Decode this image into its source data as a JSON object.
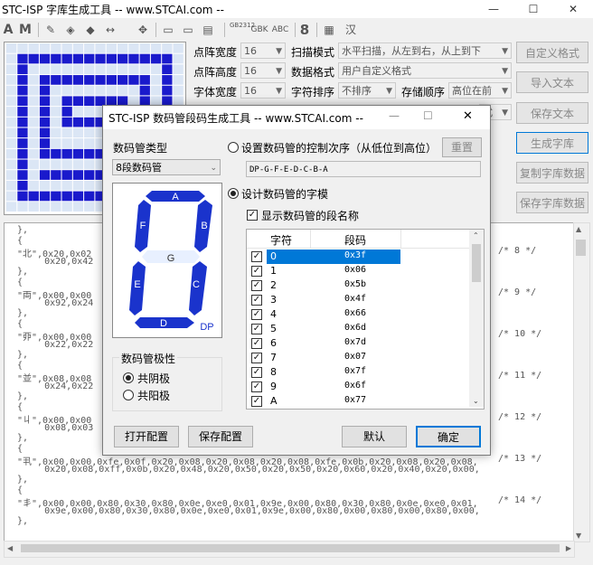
{
  "main_window": {
    "title": "STC-ISP 字库生成工具 -- www.STCAI.com --",
    "min": "—",
    "max": "☐",
    "close": "✕"
  },
  "toolbar": [
    "A",
    "M",
    "✎",
    "◈",
    "◆",
    "↔",
    "✥",
    "▭",
    "▭",
    "▤",
    "GB2312",
    "GBK",
    "ABC",
    "8",
    "▦",
    "汉"
  ],
  "settings": {
    "dot_width_label": "点阵宽度",
    "dot_width_value": "16",
    "dot_height_label": "点阵高度",
    "dot_height_value": "16",
    "font_width_label": "字体宽度",
    "font_width_value": "16",
    "scan_mode_label": "扫描模式",
    "scan_mode_value": "水平扫描，从左到右，从上到下",
    "data_format_label": "数据格式",
    "data_format_value": "用户自定义格式",
    "char_sort_label": "字符排序",
    "char_sort_value": "不排序",
    "storage_order_label": "存储顺序",
    "storage_order_value": "高位在前",
    "partial_value": "式"
  },
  "side_buttons": {
    "custom_format": "自定义格式",
    "import_text": "导入文本",
    "save_text": "保存文本",
    "generate_lib": "生成字库",
    "copy_lib": "复制字库数据",
    "save_lib": "保存字库数据"
  },
  "code_lines": [
    {
      "text": "},",
      "comment": ""
    },
    {
      "text": "{",
      "comment": ""
    },
    {
      "text": "\"北\",0x20,0x02",
      "comment": "/* 8 */"
    },
    {
      "text": "     0x20,0x42",
      "comment": ""
    },
    {
      "text": "},",
      "comment": ""
    },
    {
      "text": "{",
      "comment": ""
    },
    {
      "text": "\"両\",0x00,0x00",
      "comment": "/* 9 */"
    },
    {
      "text": "     0x92,0x24",
      "comment": ""
    },
    {
      "text": "},",
      "comment": ""
    },
    {
      "text": "{",
      "comment": ""
    },
    {
      "text": "\"丣\",0x00,0x00",
      "comment": "/* 10 */"
    },
    {
      "text": "     0x22,0x22",
      "comment": ""
    },
    {
      "text": "},",
      "comment": ""
    },
    {
      "text": "{",
      "comment": ""
    },
    {
      "text": "\"並\",0x08,0x08",
      "comment": "/* 11 */"
    },
    {
      "text": "     0x24,0x22",
      "comment": ""
    },
    {
      "text": "},",
      "comment": ""
    },
    {
      "text": "{",
      "comment": ""
    },
    {
      "text": "\"丩\",0x00,0x00",
      "comment": "/* 12 */"
    },
    {
      "text": "     0x08,0x03",
      "comment": ""
    },
    {
      "text": "},",
      "comment": ""
    },
    {
      "text": "{",
      "comment": ""
    },
    {
      "text": "\"丮\",0x00,0x00,0xfe,0x0f,0x20,0x08,0x20,0x08,0x20,0x08,0xfe,0x0b,0x20,0x08,0x20,0x08,",
      "comment": "/* 13 */"
    },
    {
      "text": "     0x20,0x08,0xff,0x0b,0x20,0x48,0x20,0x50,0x20,0x50,0x20,0x60,0x20,0x40,0x20,0x00,",
      "comment": ""
    },
    {
      "text": "},",
      "comment": ""
    },
    {
      "text": "{",
      "comment": ""
    },
    {
      "text": "\"丯\",0x00,0x00,0x80,0x30,0x80,0x0e,0xe0,0x01,0x9e,0x00,0x80,0x30,0x80,0x0e,0xe0,0x01,",
      "comment": "/* 14 */"
    },
    {
      "text": "     0x9e,0x00,0x80,0x30,0x80,0x0e,0xe0,0x01,0x9e,0x00,0x80,0x00,0x80,0x00,0x80,0x00,",
      "comment": ""
    },
    {
      "text": "},",
      "comment": ""
    }
  ],
  "dialog": {
    "title": "STC-ISP 数码管段码生成工具 -- www.STCAI.com --",
    "type_label": "数码管类型",
    "type_value": "8段数码管",
    "set_order_label": "设置数码管的控制次序（从低位到高位）",
    "reset_button": "重置",
    "order_value": "DP-G-F-E-D-C-B-A",
    "design_label": "设计数码管的字模",
    "show_names_label": "显示数码管的段名称",
    "col_char": "字符",
    "col_code": "段码",
    "segments": [
      "A",
      "B",
      "C",
      "D",
      "E",
      "F",
      "G",
      "DP"
    ],
    "polarity_label": "数码管极性",
    "common_cathode": "共阴极",
    "common_anode": "共阳极",
    "open_config": "打开配置",
    "save_config": "保存配置",
    "default_button": "默认",
    "ok_button": "确定",
    "rows": [
      {
        "char": "0",
        "code": "0x3f"
      },
      {
        "char": "1",
        "code": "0x06"
      },
      {
        "char": "2",
        "code": "0x5b"
      },
      {
        "char": "3",
        "code": "0x4f"
      },
      {
        "char": "4",
        "code": "0x66"
      },
      {
        "char": "5",
        "code": "0x6d"
      },
      {
        "char": "6",
        "code": "0x7d"
      },
      {
        "char": "7",
        "code": "0x07"
      },
      {
        "char": "8",
        "code": "0x7f"
      },
      {
        "char": "9",
        "code": "0x6f"
      },
      {
        "char": "A",
        "code": "0x77"
      }
    ]
  },
  "colors": {
    "segment_on": "#1a33cc",
    "segment_off": "#e8f0ff",
    "selection": "#0078d7",
    "grid_on": "#1a1acc"
  }
}
